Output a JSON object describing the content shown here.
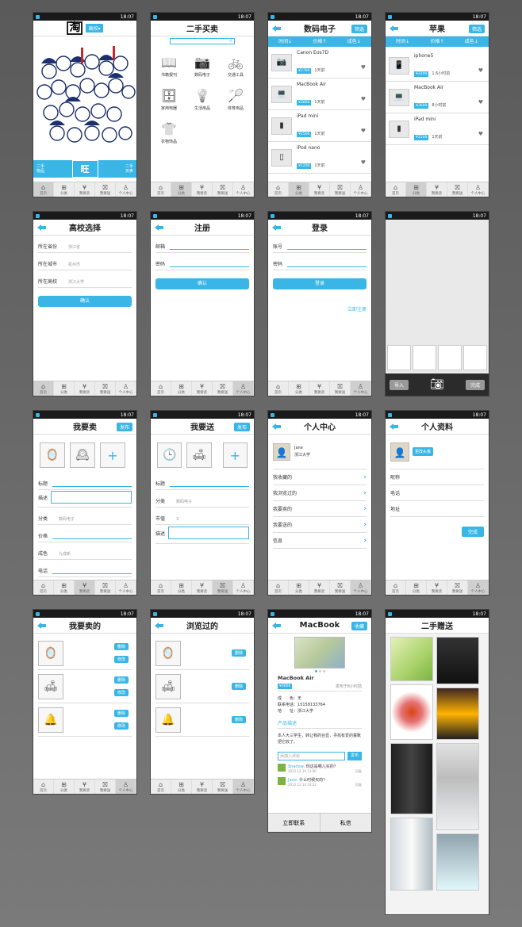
{
  "status": {
    "time": "18:07"
  },
  "tabs": [
    {
      "icon": "⌂",
      "label": "首页"
    },
    {
      "icon": "⊞",
      "label": "分类"
    },
    {
      "icon": "¥",
      "label": "我要卖"
    },
    {
      "icon": "⛝",
      "label": "我要送"
    },
    {
      "icon": "♙",
      "label": "个人中心"
    }
  ],
  "home": {
    "logo": "淘",
    "school_btn": "高校▾",
    "left_text": "二手\n物品",
    "center": "旺",
    "right_text": "二手\n买卖"
  },
  "category": {
    "title": "二手买卖",
    "items": [
      {
        "icon": "📖",
        "label": "书籍报刊"
      },
      {
        "icon": "📷",
        "label": "数码电子"
      },
      {
        "icon": "🚲",
        "label": "交通工具"
      },
      {
        "icon": "🗄",
        "label": "家用电器"
      },
      {
        "icon": "💡",
        "label": "生活用品"
      },
      {
        "icon": "🏸",
        "label": "体育用品"
      },
      {
        "icon": "👕",
        "label": "衣物饰品"
      }
    ]
  },
  "digital": {
    "title": "数码电子",
    "filter": "筛选",
    "sort": [
      "时间↓",
      "价格↑",
      "成色↓"
    ],
    "items": [
      {
        "name": "Canon Eos7D",
        "price": "¥2700",
        "time": "1天前",
        "icon": "📷"
      },
      {
        "name": "MacBook Air",
        "price": "¥3800",
        "time": "1天前",
        "icon": "💻"
      },
      {
        "name": "iPad mini",
        "price": "¥2500",
        "time": "1天前",
        "icon": "▮"
      },
      {
        "name": "iPod nano",
        "price": "¥1200",
        "time": "1天前",
        "icon": "▯"
      }
    ]
  },
  "apple": {
    "title": "苹果",
    "filter": "筛选",
    "sort": [
      "时间↓",
      "价格↑",
      "成色↓"
    ],
    "items": [
      {
        "name": "iphone5",
        "price": "¥3200",
        "time": "1.6小时前",
        "icon": "📱"
      },
      {
        "name": "MacBook Air",
        "price": "¥3600",
        "time": "8小时前",
        "icon": "💻"
      },
      {
        "name": "iPad mini",
        "price": "¥2500",
        "time": "1天前",
        "icon": "▮"
      }
    ]
  },
  "school": {
    "title": "高校选择",
    "rows": [
      {
        "label": "所在省份",
        "value": "浙江省"
      },
      {
        "label": "所在城市",
        "value": "杭州市"
      },
      {
        "label": "所在高校",
        "value": "浙江大学"
      }
    ],
    "confirm": "确认"
  },
  "register": {
    "title": "注册",
    "rows": [
      "邮箱",
      "密码"
    ],
    "confirm": "确认"
  },
  "login": {
    "title": "登录",
    "rows": [
      "账号",
      "密码"
    ],
    "btn": "登录",
    "reg": "立即注册"
  },
  "camera": {
    "import": "导入",
    "done": "完成"
  },
  "sell": {
    "title": "我要卖",
    "publish": "发布",
    "rows": [
      "标题",
      "描述",
      "分类",
      "价格",
      "成色",
      "电话"
    ],
    "cat_value": "数码电子",
    "cond_value": "九成新"
  },
  "give": {
    "title": "我要送",
    "publish": "发布",
    "rows": [
      "标题",
      "分类",
      "市值",
      "描述"
    ],
    "cat_value": "数码电子",
    "worth": "3"
  },
  "me": {
    "title": "个人中心",
    "name": "Jane",
    "school": "浙江大学",
    "menu": [
      "我收藏的",
      "我浏览过的",
      "我要卖的",
      "我要送的",
      "信息"
    ]
  },
  "profile": {
    "title": "个人资料",
    "change_avatar": "更改头像",
    "rows": [
      "昵称",
      "电话",
      "地址"
    ],
    "done": "完成"
  },
  "mysell": {
    "title": "我要卖的",
    "del": "删除",
    "edit": "修改"
  },
  "browsed": {
    "title": "浏览过的",
    "del": "删除"
  },
  "detail": {
    "title": "MacBook",
    "fav": "收藏",
    "name": "MacBook Air",
    "price": "¥3600",
    "posted": "发布于8小时前",
    "cond_label": "成　　色：",
    "cond": "无",
    "phone_label": "联系电话：",
    "phone": "15158133764",
    "addr_label": "地　　址：",
    "addr": "浙江大学",
    "desc_title": "产品描述",
    "desc": "本人大三学生，转让我的台显，寻找有爱的童靴把它收了。",
    "comment_placeholder": "添加入评论",
    "send": "发布",
    "comments": [
      {
        "user": "Shadow:",
        "text": "你这是哪儿买的?",
        "date": "2012.12.14 13:00",
        "reply": "回复"
      },
      {
        "user": "Jane:",
        "text": "什么时候买的?",
        "date": "2012.12.14 14:22",
        "reply": "回复"
      }
    ],
    "contact": "立即联系",
    "msg": "私信"
  },
  "gift": {
    "title": "二手赠送"
  }
}
